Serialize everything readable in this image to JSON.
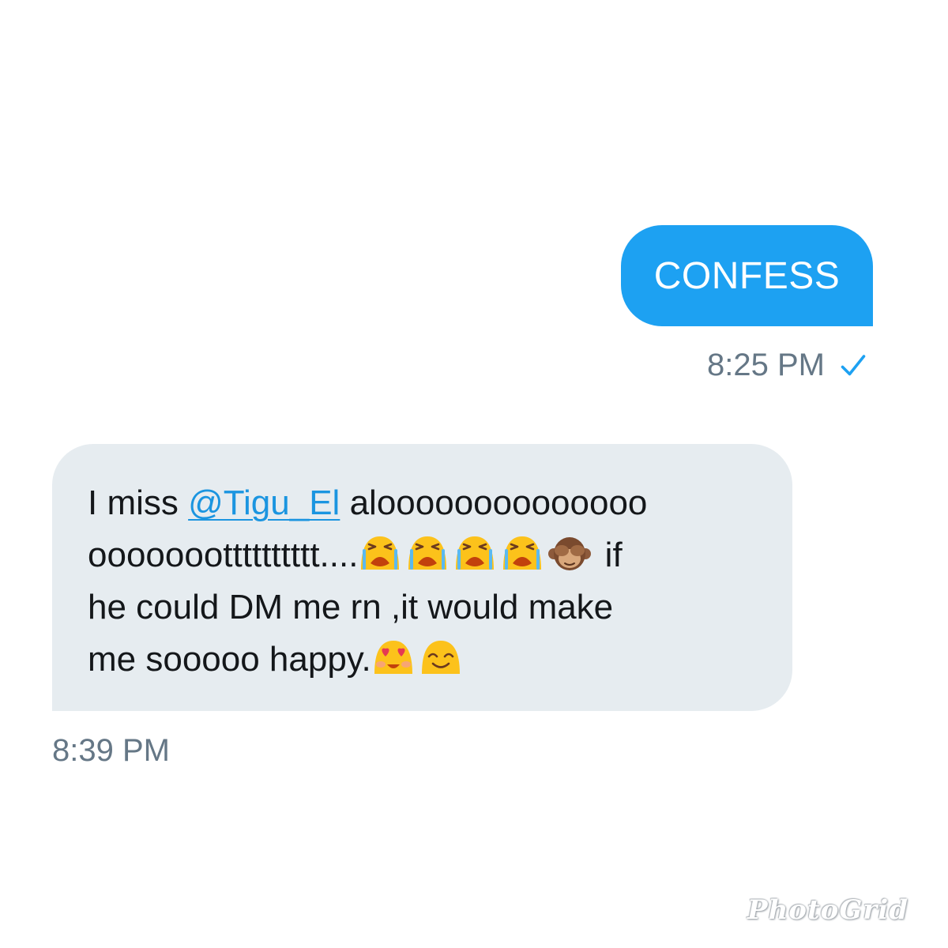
{
  "conversation": {
    "outgoing": {
      "text": "CONFESS",
      "time": "8:25 PM",
      "status_icon": "check-icon",
      "bubble_color": "#1da1f2"
    },
    "incoming": {
      "line1_prefix": "I miss ",
      "mention": "@Tigu_El",
      "line1_suffix": " aloooooooooooooo",
      "line2_text": "oooooootttttttttt....",
      "line2_emojis": [
        "loudly-crying-face",
        "loudly-crying-face",
        "loudly-crying-face",
        "loudly-crying-face",
        "see-no-evil-monkey"
      ],
      "line2_suffix": " if",
      "line3_text": "he could DM me rn ,it would make",
      "line4_text": "me sooooo happy.",
      "line4_emojis": [
        "smiling-face-with-heart-eyes",
        "smiling-face-with-smiling-eyes"
      ],
      "time": "8:39 PM",
      "bubble_color": "#e6ecf0",
      "mention_color": "#1b95e0"
    }
  },
  "watermark": {
    "text": "PhotoGrid"
  }
}
